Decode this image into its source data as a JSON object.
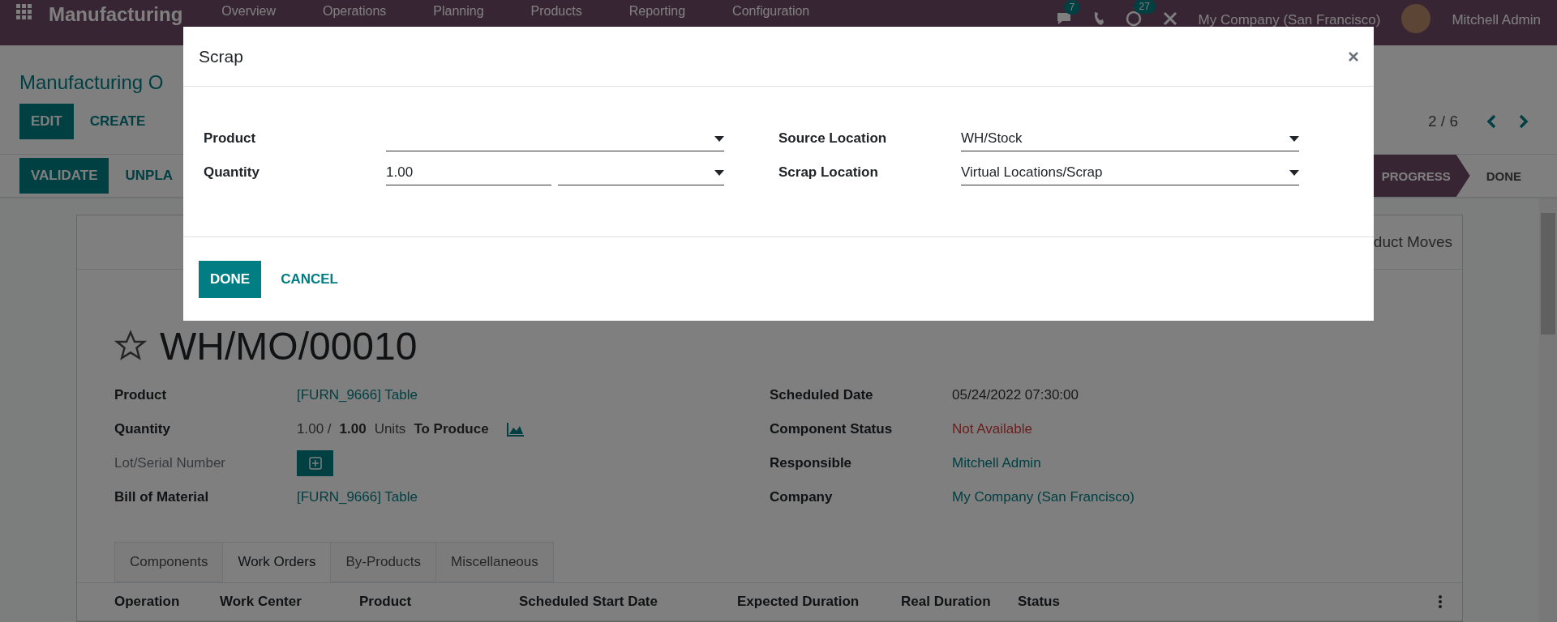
{
  "navbar": {
    "app_title": "Manufacturing",
    "menu": [
      "Overview",
      "Operations",
      "Planning",
      "Products",
      "Reporting",
      "Configuration"
    ],
    "chat_count": "7",
    "activity_count": "27",
    "company": "My Company (San Francisco)",
    "user": "Mitchell Admin"
  },
  "breadcrumb": "Manufacturing O",
  "control_buttons": [
    {
      "label": "EDIT",
      "kind": "primary"
    },
    {
      "label": "CREATE",
      "kind": "secondary"
    }
  ],
  "pager": "2 / 6",
  "action_buttons": [
    {
      "label": "VALIDATE",
      "kind": "primary"
    },
    {
      "label": "UNPLA",
      "kind": "secondary"
    }
  ],
  "status_stages": [
    {
      "label": "PROGRESS",
      "selected": true
    },
    {
      "label": "DONE",
      "selected": false
    }
  ],
  "smart_button": "duct Moves",
  "record": {
    "title": "WH/MO/00010",
    "starred": false
  },
  "fields_left": [
    {
      "label": "Product",
      "kind": "link",
      "value": "[FURN_9666] Table"
    },
    {
      "label": "Quantity",
      "kind": "quantity",
      "produced": "1.00 /",
      "target": "1.00",
      "unit": "Units",
      "suffix": "To Produce"
    },
    {
      "label": "Lot/Serial Number",
      "kind": "add_button"
    },
    {
      "label": "Bill of Material",
      "kind": "link",
      "value": "[FURN_9666] Table"
    }
  ],
  "fields_right": [
    {
      "label": "Scheduled Date",
      "kind": "text",
      "value": "05/24/2022 07:30:00"
    },
    {
      "label": "Component Status",
      "kind": "danger",
      "value": "Not Available"
    },
    {
      "label": "Responsible",
      "kind": "link",
      "value": "Mitchell Admin"
    },
    {
      "label": "Company",
      "kind": "link",
      "value": "My Company (San Francisco)"
    }
  ],
  "tabs": [
    {
      "label": "Components",
      "selected": false
    },
    {
      "label": "Work Orders",
      "selected": true
    },
    {
      "label": "By-Products",
      "selected": false
    },
    {
      "label": "Miscellaneous",
      "selected": false
    }
  ],
  "table": {
    "columns": [
      "Operation",
      "Work Center",
      "Product",
      "Scheduled Start Date",
      "Expected Duration",
      "Real Duration",
      "Status"
    ]
  },
  "dialog": {
    "title": "Scrap",
    "fields_left": [
      {
        "label": "Product",
        "kind": "select"
      },
      {
        "label": "Quantity",
        "kind": "quantity",
        "value": "1.00"
      }
    ],
    "fields_right": [
      {
        "label": "Source Location",
        "kind": "select",
        "value": "WH/Stock"
      },
      {
        "label": "Scrap Location",
        "kind": "select",
        "value": "Virtual Locations/Scrap"
      }
    ],
    "buttons": [
      {
        "label": "DONE",
        "kind": "primary"
      },
      {
        "label": "CANCEL",
        "kind": "secondary"
      }
    ]
  }
}
